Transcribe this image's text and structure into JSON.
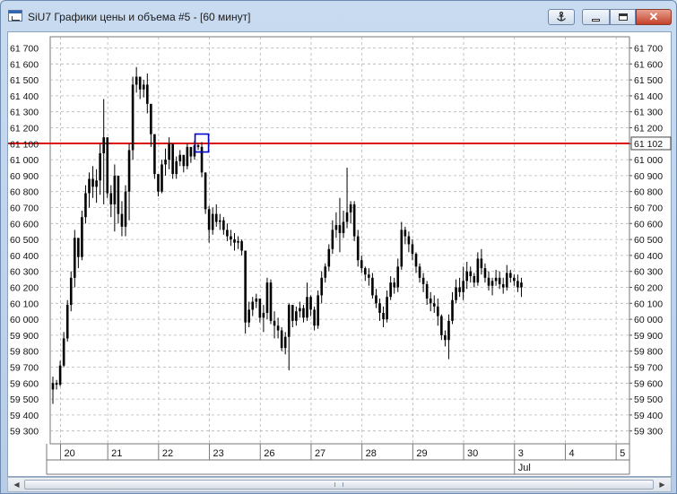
{
  "window": {
    "title": "SiU7 Графики цены и объема #5 - [60 минут]",
    "icons": {
      "app": "chart-window-icon",
      "anchor": "anchor-icon",
      "minimize": "minimize-icon",
      "maximize": "maximize-icon",
      "close": "close-icon"
    },
    "close_glyph": "✕"
  },
  "colors": {
    "candle": "#000000",
    "grid": "#b4b4b4",
    "price_line": "#dd0000",
    "highlight_box": "#0000cc"
  },
  "chart_data": {
    "type": "candlestick",
    "ylim": [
      59250,
      61800
    ],
    "y_ticks": [
      "61 700",
      "61 600",
      "61 500",
      "61 400",
      "61 300",
      "61 200",
      "61 100",
      "61 000",
      "60 900",
      "60 800",
      "60 700",
      "60 600",
      "60 500",
      "60 400",
      "60 300",
      "60 200",
      "60 100",
      "60 000",
      "59 900",
      "59 800",
      "59 700",
      "59 600",
      "59 500",
      "59 400",
      "59 300"
    ],
    "y_tick_values": [
      61700,
      61600,
      61500,
      61400,
      61300,
      61200,
      61100,
      61000,
      60900,
      60800,
      60700,
      60600,
      60500,
      60400,
      60300,
      60200,
      60100,
      60000,
      59900,
      59800,
      59700,
      59600,
      59500,
      59400,
      59300
    ],
    "current_price": 61102,
    "current_price_label": "61 102",
    "grid": true,
    "x_day_labels": [
      "20",
      "21",
      "22",
      "23",
      "26",
      "27",
      "28",
      "29",
      "30",
      "3",
      "4",
      "5"
    ],
    "x_month_labels": [
      {
        "text": "Jul",
        "day_index": 9
      }
    ],
    "day_bar_index": [
      0,
      13,
      27,
      41,
      55,
      69,
      83,
      97,
      111,
      125,
      139,
      153
    ],
    "highlight_bar_index": 41,
    "bars": [
      [
        59560,
        59640,
        59470,
        59600
      ],
      [
        59600,
        59620,
        59560,
        59590
      ],
      [
        59590,
        59740,
        59580,
        59710
      ],
      [
        59710,
        59920,
        59700,
        59880
      ],
      [
        59880,
        60120,
        59860,
        60090
      ],
      [
        60090,
        60300,
        60050,
        60260
      ],
      [
        60260,
        60560,
        60200,
        60510
      ],
      [
        60510,
        60450,
        60320,
        60390
      ],
      [
        60390,
        60680,
        60370,
        60640
      ],
      [
        60640,
        60840,
        60600,
        60790
      ],
      [
        60790,
        60920,
        60700,
        60880
      ],
      [
        60880,
        60960,
        60760,
        60830
      ],
      [
        60830,
        60940,
        60730,
        60870
      ],
      [
        60870,
        61100,
        60780,
        61040
      ],
      [
        61040,
        61380,
        60720,
        61140
      ],
      [
        61140,
        61130,
        60760,
        60790
      ],
      [
        60790,
        60840,
        60640,
        60720
      ],
      [
        60720,
        60970,
        60550,
        60900
      ],
      [
        60900,
        60870,
        60600,
        60660
      ],
      [
        60660,
        60740,
        60520,
        60580
      ],
      [
        60580,
        60840,
        60520,
        60800
      ],
      [
        60800,
        61100,
        60620,
        61060
      ],
      [
        61060,
        61520,
        61000,
        61470
      ],
      [
        61470,
        61580,
        61420,
        61520
      ],
      [
        61520,
        61500,
        61380,
        61440
      ],
      [
        61440,
        61500,
        61390,
        61470
      ],
      [
        61470,
        61540,
        61290,
        61350
      ],
      [
        61350,
        61280,
        61080,
        61160
      ],
      [
        61160,
        61140,
        60880,
        60910
      ],
      [
        60910,
        60840,
        60770,
        60800
      ],
      [
        60800,
        61000,
        60790,
        60970
      ],
      [
        60970,
        61070,
        60900,
        61000
      ],
      [
        61000,
        61140,
        60940,
        61100
      ],
      [
        61100,
        61080,
        60880,
        60910
      ],
      [
        60910,
        61020,
        60880,
        60990
      ],
      [
        60990,
        61060,
        60960,
        61030
      ],
      [
        61030,
        61020,
        60920,
        60960
      ],
      [
        60960,
        61100,
        60940,
        61080
      ],
      [
        61080,
        61070,
        60980,
        61020
      ],
      [
        61020,
        61120,
        61000,
        61090
      ],
      [
        61090,
        61100,
        61060,
        61080
      ],
      [
        61080,
        61110,
        60890,
        60920
      ],
      [
        60920,
        60840,
        60660,
        60690
      ],
      [
        60690,
        60710,
        60480,
        60560
      ],
      [
        60560,
        60700,
        60530,
        60660
      ],
      [
        60660,
        60720,
        60580,
        60610
      ],
      [
        60610,
        60660,
        60560,
        60620
      ],
      [
        60620,
        60640,
        60530,
        60560
      ],
      [
        60560,
        60600,
        60490,
        60520
      ],
      [
        60520,
        60560,
        60460,
        60500
      ],
      [
        60500,
        60540,
        60430,
        60480
      ],
      [
        60480,
        60520,
        60440,
        60490
      ],
      [
        60490,
        60500,
        60400,
        60430
      ],
      [
        60430,
        60200,
        59910,
        59980
      ],
      [
        59980,
        60110,
        59950,
        60060
      ],
      [
        60060,
        60140,
        60020,
        60110
      ],
      [
        60110,
        60160,
        60070,
        60130
      ],
      [
        60130,
        60120,
        59980,
        60010
      ],
      [
        60010,
        60090,
        59920,
        60040
      ],
      [
        60040,
        60260,
        60000,
        60230
      ],
      [
        60230,
        60250,
        59970,
        59990
      ],
      [
        59990,
        60050,
        59880,
        59960
      ],
      [
        59960,
        60010,
        59880,
        59930
      ],
      [
        59930,
        59950,
        59800,
        59820
      ],
      [
        59820,
        59920,
        59780,
        59890
      ],
      [
        59890,
        60100,
        59680,
        60090
      ],
      [
        60090,
        60070,
        59950,
        59990
      ],
      [
        59990,
        60080,
        59960,
        60050
      ],
      [
        60050,
        60110,
        60010,
        60070
      ],
      [
        60070,
        60090,
        59980,
        60010
      ],
      [
        60010,
        60230,
        59990,
        60140
      ],
      [
        60140,
        60150,
        60020,
        60060
      ],
      [
        60060,
        60080,
        59930,
        59960
      ],
      [
        59960,
        60180,
        59940,
        60150
      ],
      [
        60150,
        60300,
        60100,
        60260
      ],
      [
        60260,
        60350,
        60230,
        60330
      ],
      [
        60330,
        60470,
        60300,
        60440
      ],
      [
        60440,
        60620,
        60410,
        60560
      ],
      [
        60560,
        60670,
        60510,
        60590
      ],
      [
        60590,
        60760,
        60420,
        60540
      ],
      [
        60540,
        60680,
        60510,
        60610
      ],
      [
        60610,
        60950,
        60570,
        60670
      ],
      [
        60670,
        60740,
        60600,
        60720
      ],
      [
        60720,
        60740,
        60490,
        60520
      ],
      [
        60520,
        60560,
        60330,
        60370
      ],
      [
        60370,
        60400,
        60290,
        60320
      ],
      [
        60320,
        60330,
        60240,
        60280
      ],
      [
        60280,
        60320,
        60210,
        60260
      ],
      [
        60260,
        60290,
        60130,
        60150
      ],
      [
        60150,
        60190,
        60070,
        60100
      ],
      [
        60100,
        60130,
        59990,
        60040
      ],
      [
        60040,
        60080,
        59950,
        60000
      ],
      [
        60000,
        60180,
        59980,
        60140
      ],
      [
        60140,
        60270,
        60120,
        60230
      ],
      [
        60230,
        60260,
        60160,
        60200
      ],
      [
        60200,
        60380,
        60170,
        60330
      ],
      [
        60330,
        60610,
        60310,
        60560
      ],
      [
        60560,
        60580,
        60470,
        60520
      ],
      [
        60520,
        60550,
        60420,
        60470
      ],
      [
        60470,
        60500,
        60370,
        60410
      ],
      [
        60410,
        60420,
        60290,
        60330
      ],
      [
        60330,
        60350,
        60230,
        60260
      ],
      [
        60260,
        60290,
        60170,
        60220
      ],
      [
        60220,
        60240,
        60090,
        60130
      ],
      [
        60130,
        60170,
        60050,
        60100
      ],
      [
        60100,
        60150,
        60040,
        60080
      ],
      [
        60080,
        60130,
        59960,
        60020
      ],
      [
        60020,
        60030,
        59870,
        59900
      ],
      [
        59900,
        59930,
        59830,
        59870
      ],
      [
        59870,
        60030,
        59750,
        59990
      ],
      [
        59990,
        60170,
        59970,
        60120
      ],
      [
        60120,
        60250,
        60100,
        60200
      ],
      [
        60200,
        60260,
        60140,
        60170
      ],
      [
        60170,
        60330,
        60120,
        60240
      ],
      [
        60240,
        60360,
        60190,
        60300
      ],
      [
        60300,
        60330,
        60230,
        60270
      ],
      [
        60270,
        60290,
        60200,
        60230
      ],
      [
        60230,
        60420,
        60210,
        60380
      ],
      [
        60380,
        60440,
        60280,
        60320
      ],
      [
        60320,
        60350,
        60230,
        60260
      ],
      [
        60260,
        60300,
        60180,
        60210
      ],
      [
        60210,
        60260,
        60150,
        60240
      ],
      [
        60240,
        60310,
        60210,
        60260
      ],
      [
        60260,
        60300,
        60190,
        60220
      ],
      [
        60220,
        60260,
        60160,
        60200
      ],
      [
        60200,
        60340,
        60180,
        60290
      ],
      [
        60290,
        60310,
        60230,
        60260
      ],
      [
        60260,
        60280,
        60210,
        60240
      ],
      [
        60240,
        60280,
        60170,
        60200
      ],
      [
        60200,
        60260,
        60140,
        60230
      ]
    ]
  }
}
